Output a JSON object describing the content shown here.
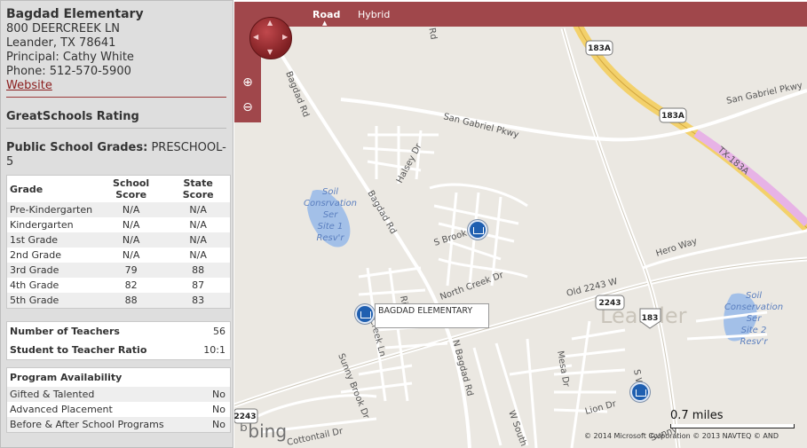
{
  "school": {
    "name": "Bagdad Elementary",
    "address1": "800 DEERCREEK LN",
    "address2": "Leander, TX 78641",
    "principal": "Principal: Cathy White",
    "phone": "Phone: 512-570-5900",
    "website": "Website"
  },
  "rating_title": "GreatSchools Rating",
  "grades": {
    "label": "Public School Grades:",
    "value": "PRESCHOOL-5"
  },
  "scores": {
    "headers": [
      "Grade",
      "School Score",
      "State Score"
    ],
    "rows": [
      {
        "grade": "Pre-Kindergarten",
        "school": "N/A",
        "state": "N/A"
      },
      {
        "grade": "Kindergarten",
        "school": "N/A",
        "state": "N/A"
      },
      {
        "grade": "1st Grade",
        "school": "N/A",
        "state": "N/A"
      },
      {
        "grade": "2nd Grade",
        "school": "N/A",
        "state": "N/A"
      },
      {
        "grade": "3rd Grade",
        "school": "79",
        "state": "88"
      },
      {
        "grade": "4th Grade",
        "school": "82",
        "state": "87"
      },
      {
        "grade": "5th Grade",
        "school": "88",
        "state": "83"
      }
    ]
  },
  "teachers": {
    "count_label": "Number of Teachers",
    "count": "56",
    "ratio_label": "Student to Teacher Ratio",
    "ratio": "10:1"
  },
  "programs": {
    "title": "Program Availability",
    "rows": [
      {
        "name": "Gifted & Talented",
        "value": "No"
      },
      {
        "name": "Advanced Placement",
        "value": "No"
      },
      {
        "name": "Before & After School Programs",
        "value": "No"
      }
    ]
  },
  "map": {
    "modes": [
      "Road",
      "Hybrid"
    ],
    "active_mode": "Road",
    "callout": "BAGDAD ELEMENTARY",
    "scale": "0.7 miles",
    "logo": "bing",
    "copyright": "© 2014 Microsoft Corporation   © 2013 NAVTEQ   © AND",
    "labels": {
      "bagdad_rd": "Bagdad Rd",
      "bagdad_rd2": "Bagdad Rd",
      "n_bagdad_rd": "N Bagdad Rd",
      "san_gabriel": "San Gabriel Pkwy",
      "san_gabriel_e": "San Gabriel Pkwy",
      "halsey": "Halsey Dr",
      "s_brook": "S Brook",
      "north_creek": "North Creek Dr",
      "old_2243": "Old 2243 W",
      "hero_way": "Hero Way",
      "mesa": "Mesa Dr",
      "lion": "Lion Dr",
      "s_south": "W South",
      "sunny_brook": "Sunny Brook Dr",
      "creek_ln": "Creek Ln",
      "cottontail": "Cottontail Dr",
      "river_ln": "Ri   Ln",
      "leander": "Leander",
      "tx183a": "TX-183A",
      "rove": "rove Rd",
      "soil1": [
        "Soil",
        "Consrvation",
        "Ser",
        "Site 1",
        "Resv'r"
      ],
      "soil2": [
        "Soil",
        "Conservation",
        "Ser",
        "Site 2",
        "Resv'r"
      ],
      "shield_183a_1": "183A",
      "shield_183a_2": "183A",
      "shield_2243": "2243",
      "shield_2243_w": "2243",
      "shield_183": "183",
      "s_w": "S W",
      "sunny": "Sunny"
    }
  }
}
